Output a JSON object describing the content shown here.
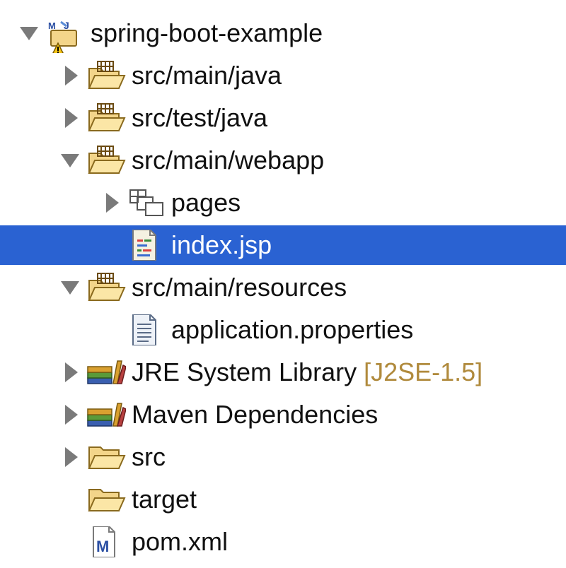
{
  "tree": {
    "project": {
      "label": "spring-boot-example",
      "icon": "maven-project-warning-icon",
      "expanded": true
    },
    "items": [
      {
        "label": "src/main/java",
        "icon": "source-folder-icon",
        "expanded": false
      },
      {
        "label": "src/test/java",
        "icon": "source-folder-icon",
        "expanded": false
      },
      {
        "label": "src/main/webapp",
        "icon": "source-folder-icon",
        "expanded": true
      },
      {
        "label": "pages",
        "icon": "package-icon",
        "expanded": false
      },
      {
        "label": "index.jsp",
        "icon": "jsp-file-icon",
        "selected": true
      },
      {
        "label": "src/main/resources",
        "icon": "source-folder-icon",
        "expanded": true
      },
      {
        "label": "application.properties",
        "icon": "properties-file-icon"
      },
      {
        "label": "JRE System Library",
        "decorator": "[J2SE-1.5]",
        "icon": "library-icon",
        "expanded": false
      },
      {
        "label": "Maven Dependencies",
        "icon": "library-icon",
        "expanded": false
      },
      {
        "label": "src",
        "icon": "folder-icon",
        "expanded": false
      },
      {
        "label": "target",
        "icon": "folder-icon"
      },
      {
        "label": "pom.xml",
        "icon": "maven-pom-icon"
      }
    ]
  },
  "colors": {
    "selection": "#2a62d2",
    "decorator": "#b08a3c",
    "folder": "#f3d58a",
    "folder_outline": "#8a6a1e"
  }
}
